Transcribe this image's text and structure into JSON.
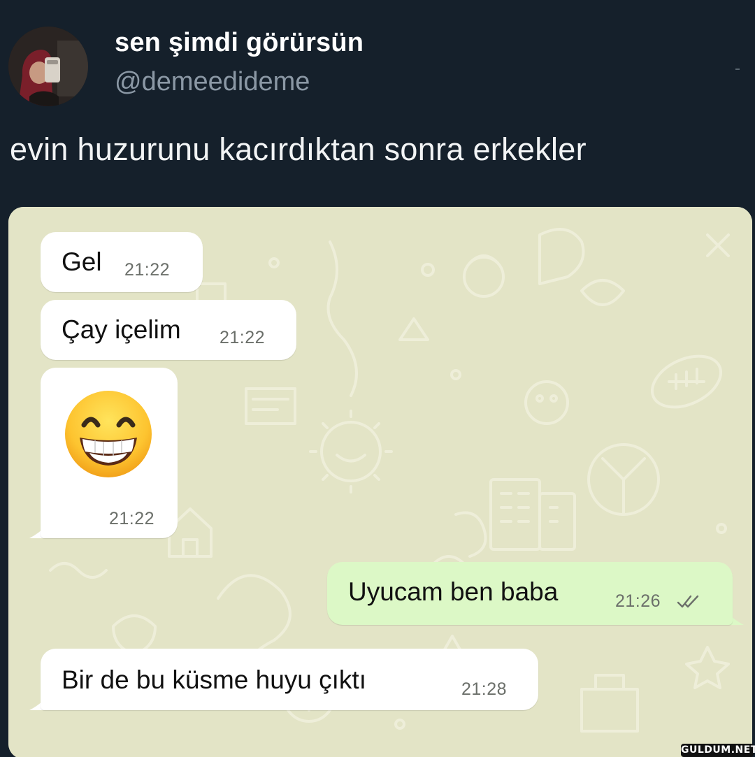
{
  "tweet": {
    "display_name": "sen şimdi görürsün",
    "handle": "@demeedideme",
    "text": "evin huzurunu kacırdıktan sonra erkekler",
    "avatar_icon": "profile-photo"
  },
  "chat": {
    "wallpaper_color": "#e3e4c6",
    "incoming_color": "#ffffff",
    "outgoing_color": "#dcf8c6",
    "messages": [
      {
        "direction": "in",
        "text": "Gel",
        "time": "21:22"
      },
      {
        "direction": "in",
        "text": "Çay içelim",
        "time": "21:22"
      },
      {
        "direction": "in",
        "emoji": "grinning-face-with-smiling-eyes",
        "time": "21:22"
      },
      {
        "direction": "out",
        "text": "Uyucam ben baba",
        "time": "21:26",
        "status_icon": "double-check-icon"
      },
      {
        "direction": "in",
        "text": "Bir de bu küsme huyu çıktı",
        "time": "21:28"
      }
    ]
  },
  "watermark": {
    "text": "GULDUM.NET"
  }
}
